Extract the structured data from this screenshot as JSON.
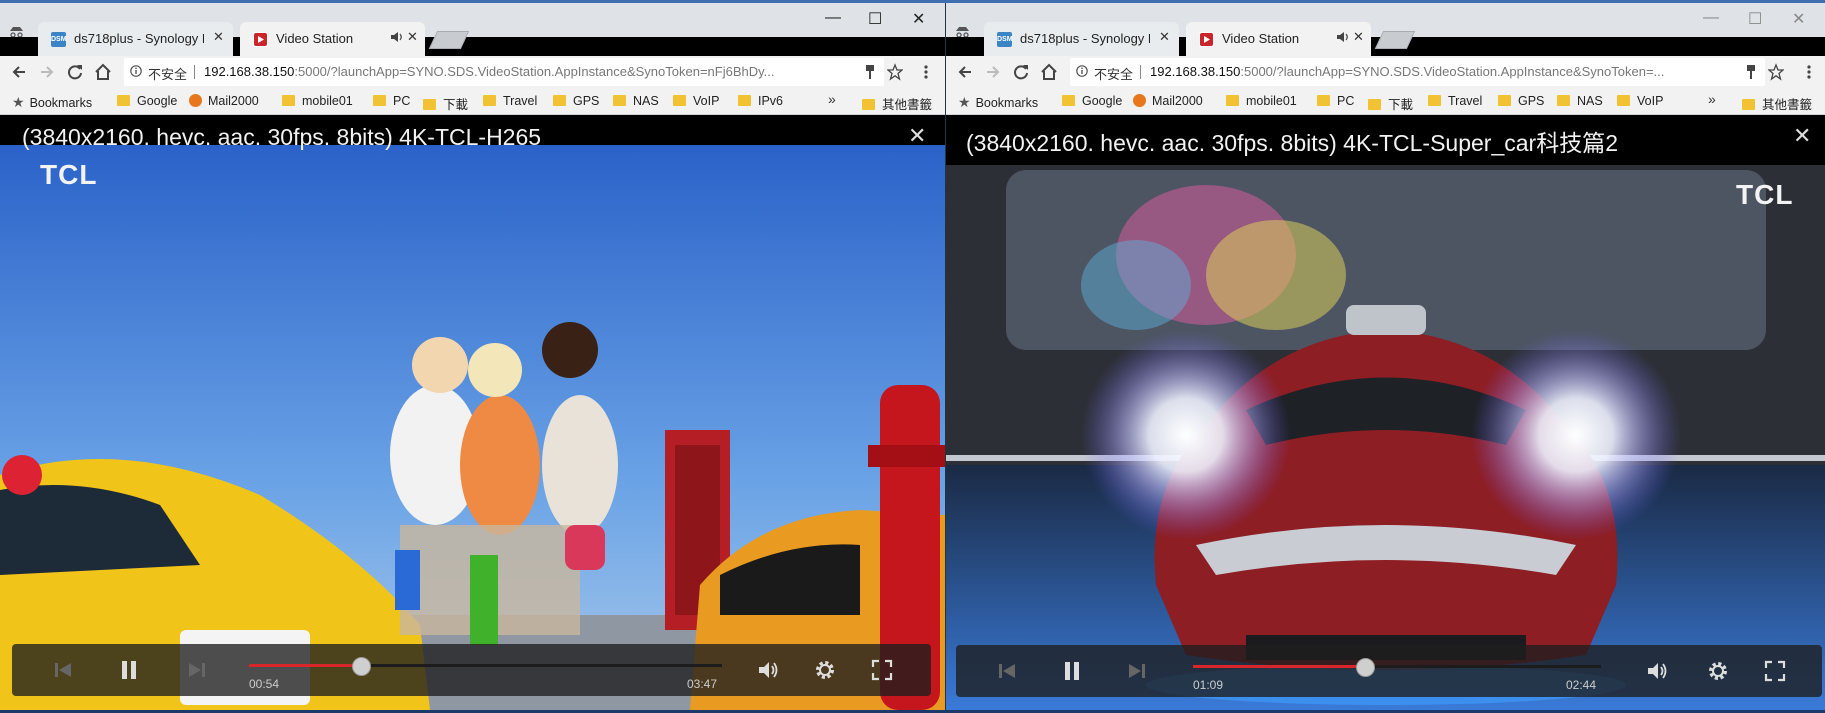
{
  "left": {
    "tabs": [
      {
        "title": "ds718plus - Synology D"
      },
      {
        "title": "Video Station"
      }
    ],
    "address": {
      "security_label": "不安全",
      "host": "192.168.38.150",
      "rest": ":5000/?launchApp=SYNO.SDS.VideoStation.AppInstance&SynoToken=nFj6BhDy..."
    },
    "bookmarks": {
      "label": "Bookmarks",
      "items": [
        "Google",
        "Mail2000",
        "mobile01",
        "PC",
        "下載",
        "Travel",
        "GPS",
        "NAS",
        "VoIP",
        "IPv6"
      ],
      "more": "»",
      "other": "其他書籤"
    },
    "video": {
      "title": "(3840x2160. hevc. aac. 30fps. 8bits) 4K-TCL-H265",
      "logo": "TCL",
      "elapsed": "00:54",
      "duration": "03:47",
      "progress": 0.2378
    }
  },
  "right": {
    "tabs": [
      {
        "title": "ds718plus - Synology D"
      },
      {
        "title": "Video Station"
      }
    ],
    "address": {
      "security_label": "不安全",
      "host": "192.168.38.150",
      "rest": ":5000/?launchApp=SYNO.SDS.VideoStation.AppInstance&SynoToken=..."
    },
    "bookmarks": {
      "label": "Bookmarks",
      "items": [
        "Google",
        "Mail2000",
        "mobile01",
        "PC",
        "下載",
        "Travel",
        "GPS",
        "NAS",
        "VoIP"
      ],
      "more": "»",
      "other": "其他書籤"
    },
    "video": {
      "title": "(3840x2160. hevc. aac. 30fps. 8bits) 4K-TCL-Super_car科技篇2",
      "logo": "TCL",
      "elapsed": "01:09",
      "duration": "02:44",
      "progress": 0.4207
    }
  },
  "favicon_label": "DSM",
  "colors": {
    "chrome_frame": "#dfe3e8",
    "toolbar": "#f2f2f2",
    "progress_played": "#d9262b",
    "folder": "#f1c232"
  },
  "icons": [
    "incognito-icon",
    "speaker-icon",
    "back-icon",
    "forward-icon",
    "reload-icon",
    "home-icon",
    "info-icon",
    "key-icon",
    "star-icon",
    "menu-icon",
    "previous-icon",
    "pause-icon",
    "next-icon",
    "volume-icon",
    "settings-icon",
    "fullscreen-icon",
    "close-icon"
  ]
}
